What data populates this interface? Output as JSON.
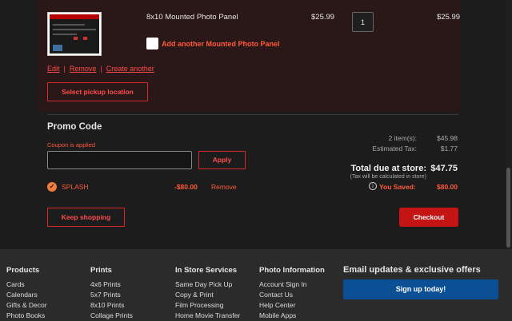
{
  "cart_item": {
    "name": "8x10 Mounted Photo Panel",
    "price": "$25.99",
    "quantity": "1",
    "total": "$25.99",
    "addon_label": "Add another Mounted Photo Panel",
    "addon_checked": false,
    "links": {
      "edit": "Edit",
      "remove": "Remove",
      "create_another": "Create another",
      "separator": "|"
    },
    "pickup_button": "Select pickup location"
  },
  "promo": {
    "title": "Promo Code",
    "note": "Coupon is applied",
    "input_value": "",
    "apply_button": "Apply",
    "coupon": {
      "code": "SPLASH",
      "amount": "-$80.00",
      "remove": "Remove"
    }
  },
  "summary": {
    "items_label": "2 item(s):",
    "items_value": "$45.98",
    "tax_label": "Estimated Tax:",
    "tax_value": "$1.77",
    "total_label": "Total due at store:",
    "total_value": "$47.75",
    "tax_note": "(Tax will be calculated in store)",
    "saved_label": "You Saved:",
    "saved_value": "$80.00",
    "info_glyph": "i"
  },
  "actions": {
    "keep_shopping": "Keep shopping",
    "checkout": "Checkout"
  },
  "footer": {
    "columns": [
      {
        "title": "Products",
        "items": [
          "Cards",
          "Calendars",
          "Gifts & Decor",
          "Photo Books"
        ]
      },
      {
        "title": "Prints",
        "items": [
          "4x6 Prints",
          "5x7 Prints",
          "8x10 Prints",
          "Collage Prints"
        ]
      },
      {
        "title": "In Store Services",
        "items": [
          "Same Day Pick Up",
          "Copy & Print",
          "Film Processing",
          "Home Movie Transfer"
        ]
      },
      {
        "title": "Photo Information",
        "items": [
          "Account Sign In",
          "Contact Us",
          "Help Center",
          "Mobile Apps"
        ]
      }
    ],
    "email_title": "Email updates & exclusive offers",
    "signup_button": "Sign up today!"
  },
  "colors": {
    "accent": "#ff4d4d",
    "coupon": "#ff5a3c",
    "checkout": "#c41414",
    "signup": "#0b4f95"
  }
}
